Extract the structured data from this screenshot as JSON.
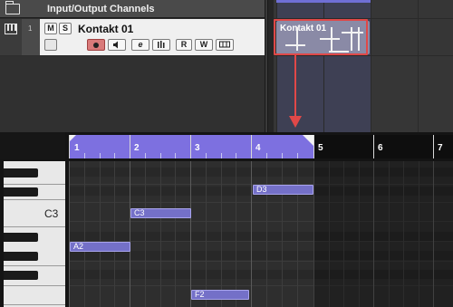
{
  "tracklist": {
    "folder_track": {
      "title": "Input/Output Channels"
    },
    "instrument_track": {
      "number": "1",
      "name": "Kontakt 01",
      "mute_label": "M",
      "solo_label": "S",
      "edit_label": "e",
      "read_label": "R",
      "write_label": "W"
    }
  },
  "arrange": {
    "part": {
      "name": "Kontakt 01"
    }
  },
  "key_editor": {
    "ruler": {
      "bars": [
        "1",
        "2",
        "3",
        "4",
        "5",
        "6",
        "7"
      ]
    },
    "keyboard": {
      "c3_label": "C3"
    },
    "notes": [
      {
        "label": "D3"
      },
      {
        "label": "C3"
      },
      {
        "label": "A2"
      },
      {
        "label": "F2"
      }
    ]
  },
  "colors": {
    "highlight": "#e04848",
    "cycle": "#7d70e0",
    "note_fill": "#7470c8",
    "part_fill": "#8a8aa6"
  },
  "icons": [
    "folder-icon",
    "piano-icon",
    "record-icon",
    "monitor-icon",
    "edit-icon",
    "mixer-icon",
    "lanes-icon"
  ]
}
